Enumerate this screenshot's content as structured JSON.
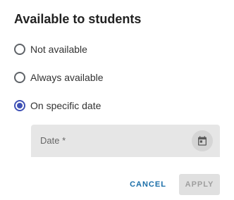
{
  "dialog": {
    "title": "Available to students"
  },
  "options": [
    {
      "label": "Not available",
      "checked": false
    },
    {
      "label": "Always available",
      "checked": false
    },
    {
      "label": "On specific date",
      "checked": true
    }
  ],
  "date_field": {
    "label": "Date *",
    "value": "",
    "icon": "calendar-icon"
  },
  "actions": {
    "cancel_label": "CANCEL",
    "apply_label": "APPLY",
    "apply_enabled": false
  },
  "colors": {
    "accent": "#3f51b5",
    "cancel_text": "#1a6ea8",
    "disabled_text": "#9e9e9e",
    "field_background": "#e6e6e6"
  }
}
